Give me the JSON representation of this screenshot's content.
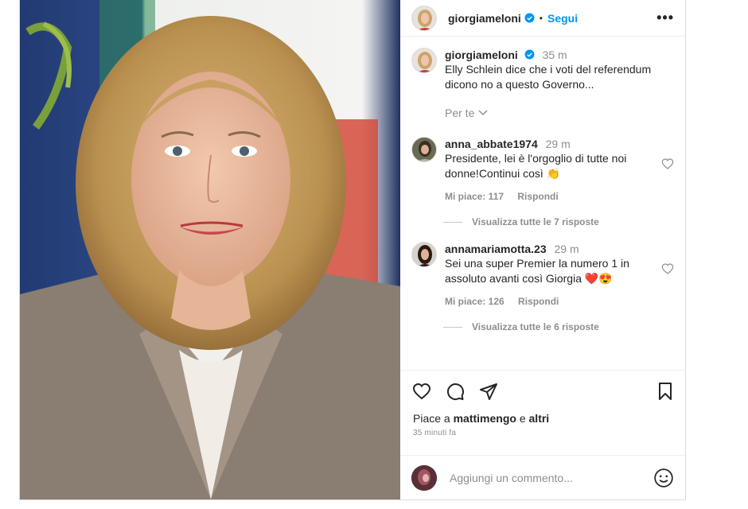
{
  "post": {
    "username": "giorgiameloni",
    "follow_label": "Segui",
    "dot": "•",
    "more": "•••",
    "caption": {
      "username": "giorgiameloni",
      "time": "35 m",
      "text": "Elly Schlein dice che i voti del referendum dicono no a questo Governo..."
    },
    "filter_label": "Per te",
    "comments": [
      {
        "username": "anna_abbate1974",
        "time": "29 m",
        "text": "Presidente, lei è l'orgoglio di tutte noi donne!Continui così 👏",
        "likes": "Mi piace: 117",
        "reply_label": "Rispondi",
        "view_replies": "Visualizza tutte le 7 risposte"
      },
      {
        "username": "annamariamotta.23",
        "time": "29 m",
        "text": "Sei una super Premier la numero 1 in assoluto avanti così Giorgia ❤️😍",
        "likes": "Mi piace: 126",
        "reply_label": "Rispondi",
        "view_replies": "Visualizza tutte le 6 risposte"
      }
    ],
    "liked_by_prefix": "Piace a",
    "liked_by_user": "mattimengo",
    "liked_by_mid": "e",
    "liked_by_others": "altri",
    "posted_ago": "35 minuti fa",
    "add_comment_placeholder": "Aggiungi un commento..."
  },
  "colors": {
    "accent": "#0095f6",
    "muted": "#8e8e8e",
    "verified": "#0095f6"
  },
  "icons": [
    "verified-badge-icon",
    "more-options-icon",
    "chevron-down-icon",
    "heart-icon",
    "comment-icon",
    "share-icon",
    "bookmark-icon",
    "emoji-icon"
  ]
}
